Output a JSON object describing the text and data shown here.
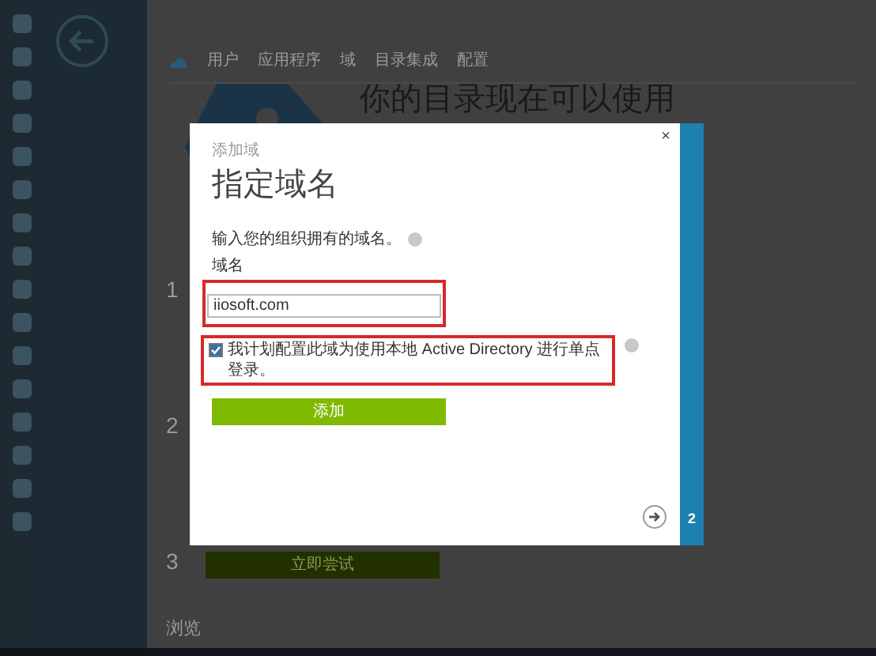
{
  "background": {
    "tabs": [
      {
        "label": "用户",
        "selected": false
      },
      {
        "label": "应用程序",
        "selected": false
      },
      {
        "label": "域",
        "selected": false
      },
      {
        "label": "目录集成",
        "selected": false
      },
      {
        "label": "配置",
        "selected": false
      }
    ],
    "heading": "你的目录现在可以使用",
    "steps": [
      "1",
      "2",
      "3"
    ],
    "try_button": "立即尝试",
    "browse": "浏览"
  },
  "dialog": {
    "close": "×",
    "subtitle": "添加域",
    "title": "指定域名",
    "prompt": "输入您的组织拥有的域名。",
    "field_label": "域名",
    "domain_value": "iiosoft.com",
    "sso_checkbox": {
      "label": "我计划配置此域为使用本地 Active Directory 进行单点登录。",
      "checked": true
    },
    "add_button": "添加",
    "step_number": "2"
  }
}
